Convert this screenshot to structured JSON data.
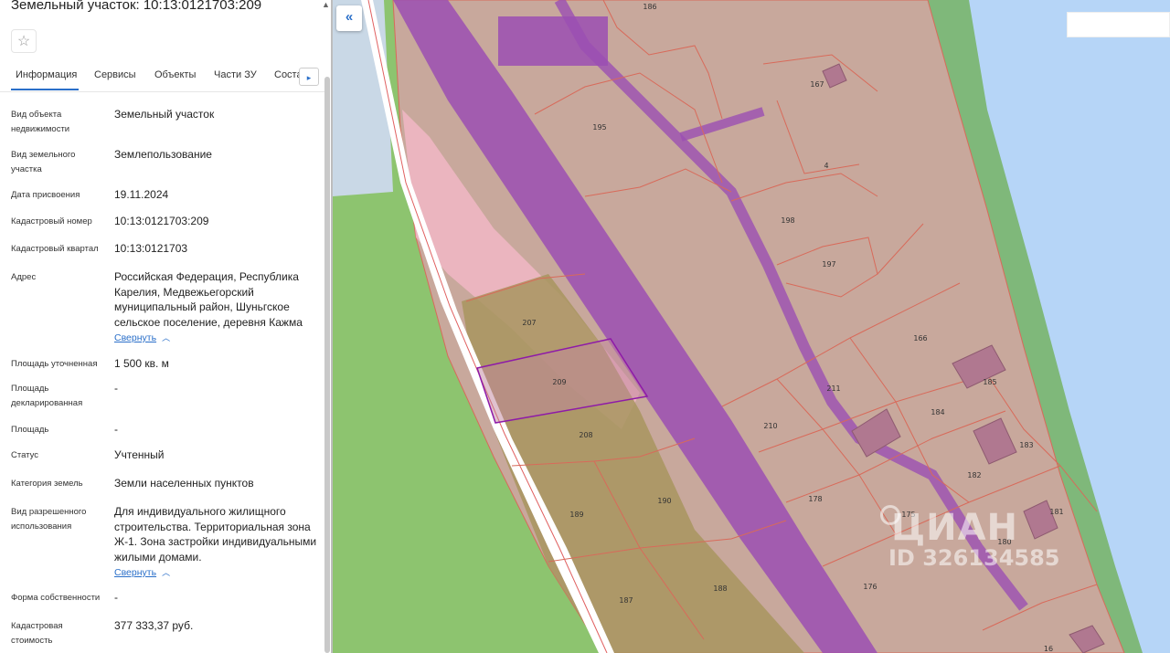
{
  "panel": {
    "title": "Земельный участок: 10:13:0121703:209",
    "scroll_up": "▲",
    "star_icon": "☆",
    "tabs": [
      "Информация",
      "Сервисы",
      "Объекты",
      "Части ЗУ",
      "Соста"
    ],
    "tab_more": "▸",
    "rows": {
      "object_type": {
        "label": "Вид объекта недвижимости",
        "value": "Земельный участок"
      },
      "land_type": {
        "label": "Вид земельного участка",
        "value": "Землепользование"
      },
      "assign_date": {
        "label": "Дата присвоения",
        "value": "19.11.2024"
      },
      "cadastral_number": {
        "label": "Кадастровый номер",
        "value": "10:13:0121703:209"
      },
      "cadastral_quarter": {
        "label": "Кадастровый квартал",
        "value": "10:13:0121703"
      },
      "address": {
        "label": "Адрес",
        "value": "Российская Федерация, Республика Карелия, Медвежьегорский муниципальный район, Шуньгское сельское поселение, деревня Кажма",
        "link": "Свернуть"
      },
      "area_refined": {
        "label": "Площадь уточненная",
        "value": "1 500 кв. м"
      },
      "area_declared": {
        "label": "Площадь декларированная",
        "value": "-"
      },
      "area": {
        "label": "Площадь",
        "value": "-"
      },
      "status": {
        "label": "Статус",
        "value": "Учтенный"
      },
      "land_category": {
        "label": "Категория земель",
        "value": "Земли населенных пунктов"
      },
      "permitted_use": {
        "label": "Вид разрешенного использования",
        "value": "Для индивидуального жилищного строительства. Территориальная зона Ж-1. Зона застройки индивидуальными жилыми домами.",
        "link": "Свернуть"
      },
      "ownership": {
        "label": "Форма собственности",
        "value": "-"
      },
      "cadastral_cost": {
        "label": "Кадастровая стоимость",
        "value": "377 333,37 руб."
      }
    }
  },
  "map": {
    "collapse_icon": "«",
    "plot_numbers": [
      "186",
      "167",
      "195",
      "4",
      "198",
      "197",
      "207",
      "209",
      "166",
      "211",
      "185",
      "184",
      "210",
      "208",
      "183",
      "182",
      "190",
      "178",
      "189",
      "175",
      "181",
      "180",
      "188",
      "187",
      "176",
      "16"
    ],
    "watermark_brand": "ЦИАН",
    "watermark_id": "ID 326134585",
    "colors": {
      "water": "#b6d5f7",
      "parcel": "#c8a89c",
      "green": "#8dc46f",
      "purple_zone": "#9b4fb3",
      "pink_zone": "#f4b8c8",
      "selected_outline": "#8e1aa8"
    }
  }
}
